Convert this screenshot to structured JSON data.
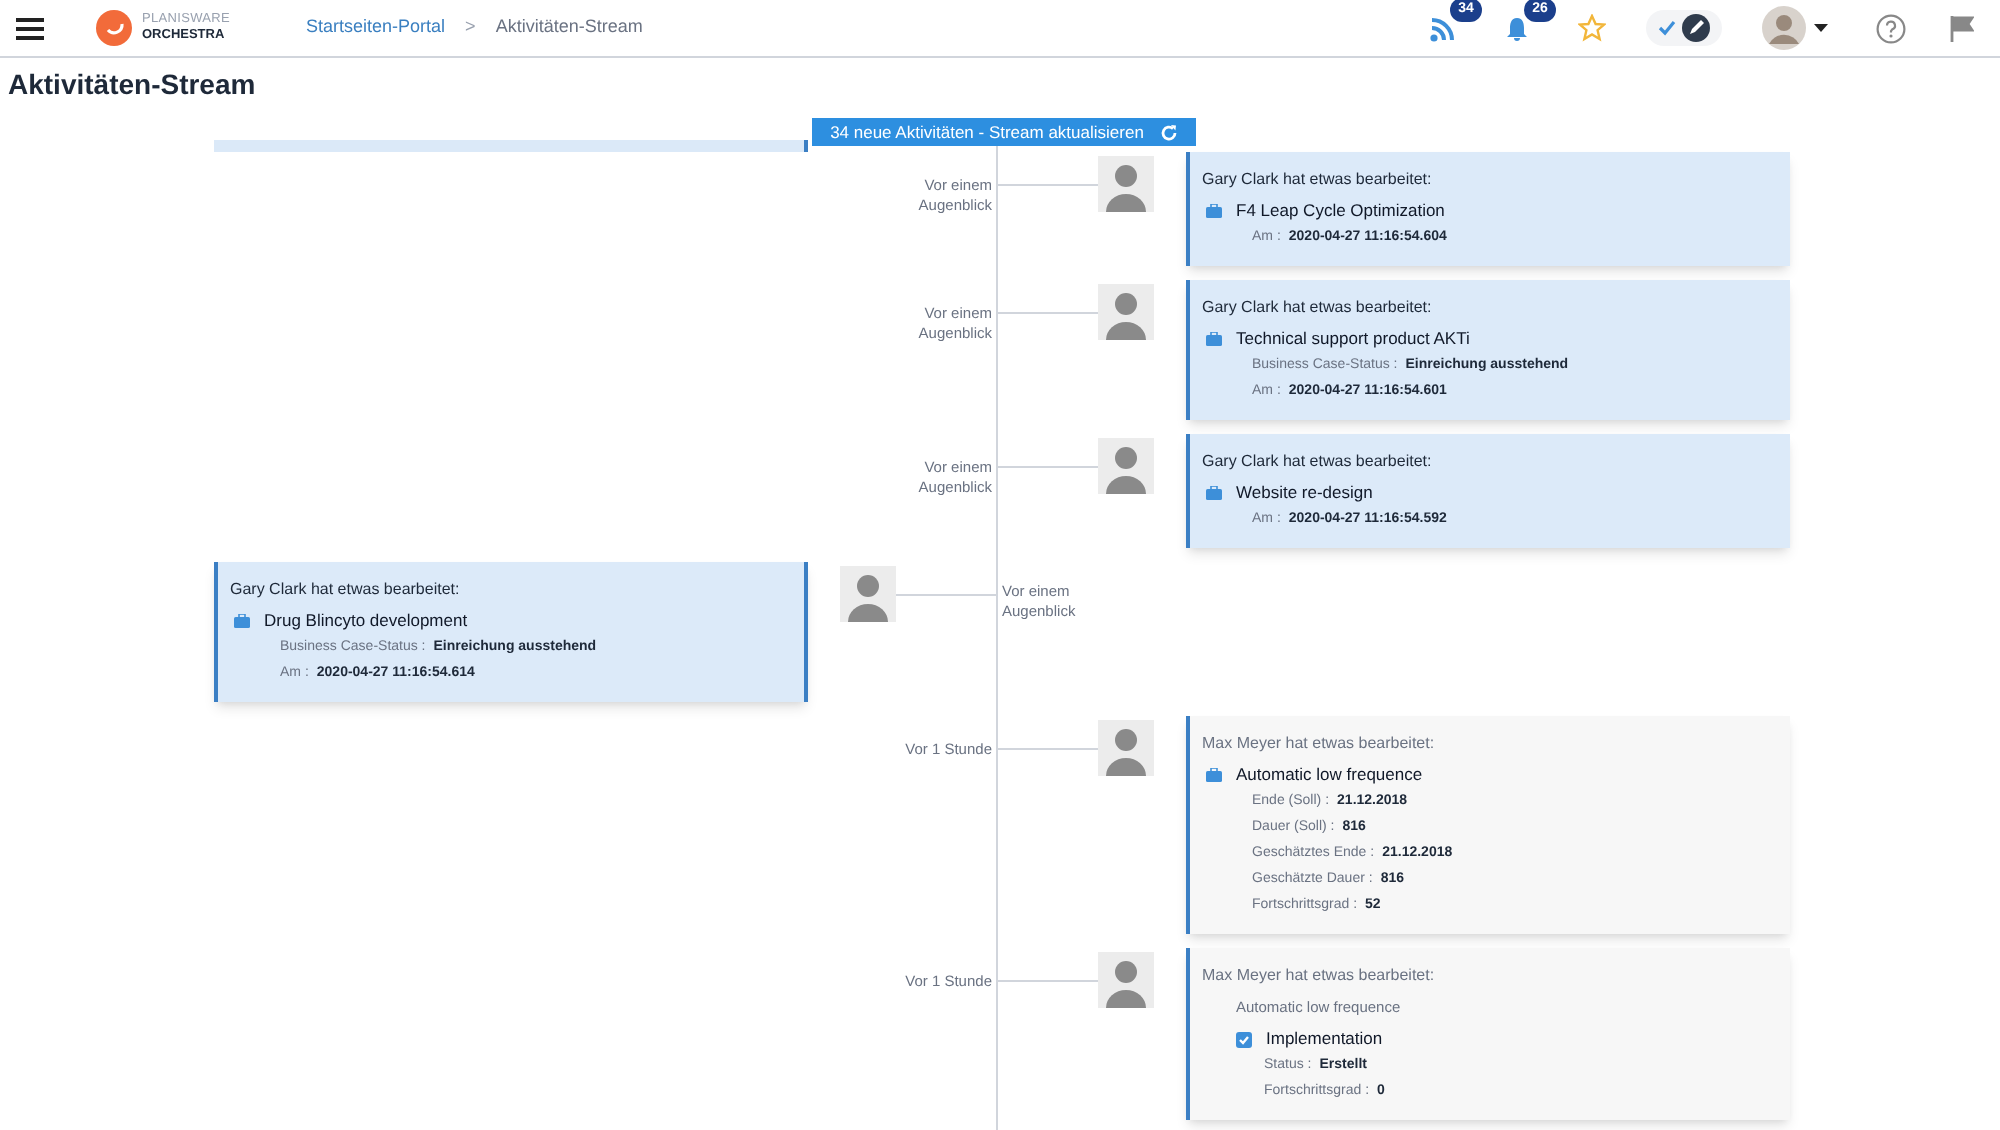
{
  "header": {
    "logo": {
      "line_1": "PLANISWARE",
      "line_2": "ORCHESTRA"
    },
    "breadcrumb": {
      "items": [
        "Startseiten-Portal",
        "Aktivitäten-Stream"
      ],
      "separator": ">"
    },
    "notifications": [
      {
        "kind": "feed",
        "count": "34"
      },
      {
        "kind": "bell",
        "count": "26"
      }
    ]
  },
  "mode_toggle": {
    "on": true
  },
  "page_title": "Aktivitäten-Stream",
  "refresh_button": {
    "label": "34 neue Aktivitäten - Stream aktualisieren"
  },
  "entries": [
    {
      "kind": "right",
      "new": true,
      "time": "Vor einem Augenblick",
      "author_line": "Gary Clark hat etwas bearbeitet:",
      "item": {
        "kind": "project",
        "title": "F4 Leap Cycle Optimization",
        "fields": [
          {
            "label": "Am :",
            "value": "2020-04-27 11:16:54.604"
          }
        ]
      }
    },
    {
      "kind": "right",
      "new": true,
      "time": "Vor einem Augenblick",
      "author_line": "Gary Clark hat etwas bearbeitet:",
      "item": {
        "kind": "project",
        "title": "Technical support product AKTi",
        "fields": [
          {
            "label": "Business Case-Status :",
            "value": "Einreichung ausstehend"
          },
          {
            "label": "Am :",
            "value": "2020-04-27 11:16:54.601"
          }
        ]
      }
    },
    {
      "kind": "right",
      "new": true,
      "time": "Vor einem Augenblick",
      "author_line": "Gary Clark hat etwas bearbeitet:",
      "item": {
        "kind": "project",
        "title": "Website re-design",
        "fields": [
          {
            "label": "Am :",
            "value": "2020-04-27 11:16:54.592"
          }
        ]
      }
    },
    {
      "kind": "left",
      "new": true,
      "time": "Vor einem Augenblick",
      "author_line": "Gary Clark hat etwas bearbeitet:",
      "item": {
        "kind": "project",
        "title": "Drug Blincyto development",
        "fields": [
          {
            "label": "Business Case-Status :",
            "value": "Einreichung ausstehend"
          },
          {
            "label": "Am :",
            "value": "2020-04-27 11:16:54.614"
          }
        ]
      }
    },
    {
      "kind": "right",
      "new": false,
      "time": "Vor 1 Stunde",
      "author_line": "Max Meyer hat etwas bearbeitet:",
      "item": {
        "kind": "project",
        "title": "Automatic low frequence",
        "fields": [
          {
            "label": "Ende (Soll) :",
            "value": "21.12.2018"
          },
          {
            "label": "Dauer (Soll) :",
            "value": "816"
          },
          {
            "label": "Geschätztes Ende :",
            "value": "21.12.2018"
          },
          {
            "label": "Geschätzte Dauer :",
            "value": "816"
          },
          {
            "label": "Fortschrittsgrad :",
            "value": "52"
          }
        ]
      }
    },
    {
      "kind": "right",
      "new": false,
      "time": "Vor 1 Stunde",
      "author_line": "Max Meyer hat etwas bearbeitet:",
      "item": {
        "kind": "task",
        "parent": "Automatic low frequence",
        "title": "Implementation",
        "fields": [
          {
            "label": "Status :",
            "value": "Erstellt"
          },
          {
            "label": "Fortschrittsgrad :",
            "value": "0"
          }
        ]
      }
    }
  ]
}
